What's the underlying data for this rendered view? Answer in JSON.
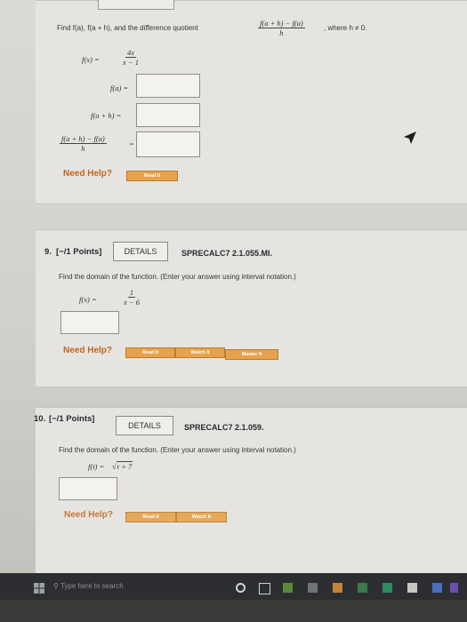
{
  "q8": {
    "prompt_lead": "Find f(a), f(a + h), and the difference quotient",
    "dq_num": "f(a + h) − f(a)",
    "dq_den": "h",
    "prompt_tail": ", where h ≠ 0.",
    "func_lhs": "f(x) =",
    "func_num": "4x",
    "func_den": "x − 1",
    "row_fa": "f(a) =",
    "row_fah": "f(a + h) =",
    "row_dq_num": "f(a + h) − f(a)",
    "row_dq_den": "h",
    "row_dq_eq": "=",
    "need_help": "Need Help?",
    "read_it": "Read It"
  },
  "q9": {
    "number": "9.",
    "points": "[−/1 Points]",
    "details": "DETAILS",
    "code": "SPRECALC7 2.1.055.MI.",
    "prompt": "Find the domain of the function. (Enter your answer using interval notation.)",
    "func_lhs": "f(x) =",
    "func_num": "1",
    "func_den": "x − 6",
    "need_help": "Need Help?",
    "read_it": "Read It",
    "watch_it": "Watch It",
    "master_it": "Master It"
  },
  "q10": {
    "number": "10.",
    "points": "[−/1 Points]",
    "details": "DETAILS",
    "code": "SPRECALC7 2.1.059.",
    "prompt": "Find the domain of the function. (Enter your answer using interval notation.)",
    "func_lhs": "f(t) =",
    "func_rad": "t + 7",
    "need_help": "Need Help?",
    "read_it": "Read It",
    "watch_it": "Watch It"
  },
  "taskbar": {
    "search_placeholder": "Type here to search"
  },
  "colors": {
    "accent_orange": "#e6a24c",
    "help_text": "#c0661e"
  }
}
